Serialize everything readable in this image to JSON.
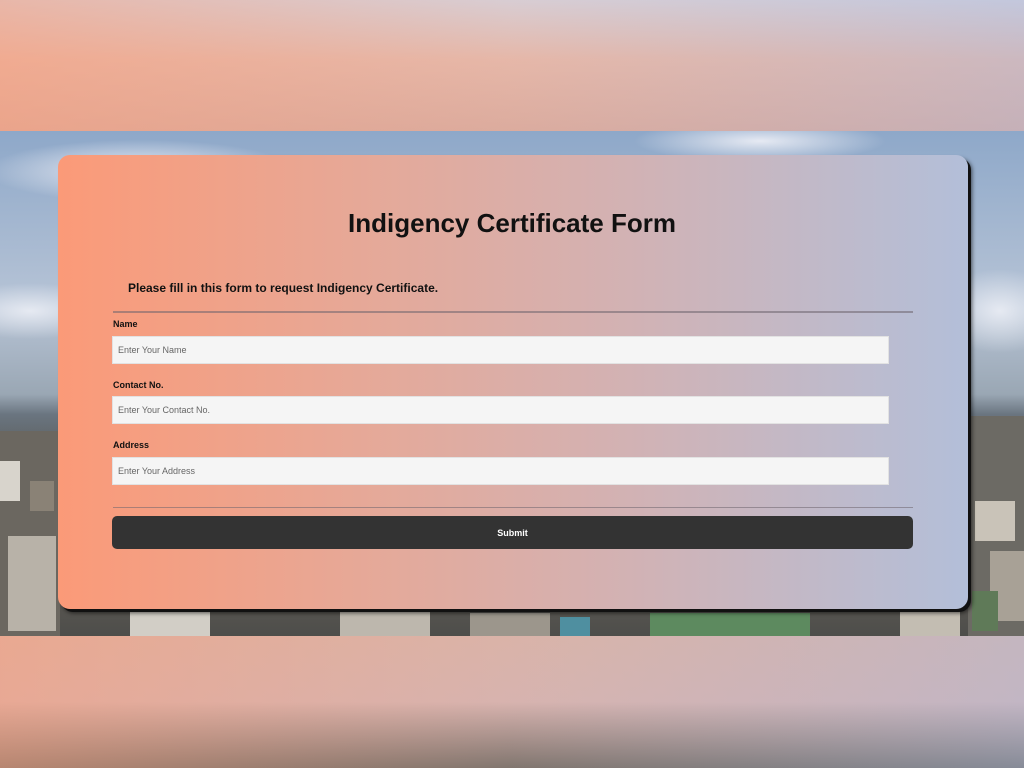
{
  "form": {
    "title": "Indigency Certificate Form",
    "subtitle": "Please fill in this form to request Indigency Certificate.",
    "fields": [
      {
        "label": "Name",
        "placeholder": "Enter Your Name",
        "value": ""
      },
      {
        "label": "Contact No.",
        "placeholder": "Enter Your Contact No.",
        "value": ""
      },
      {
        "label": "Address",
        "placeholder": "Enter Your Address",
        "value": ""
      }
    ],
    "submit_label": "Submit"
  },
  "colors": {
    "card_gradient_start": "#fb9a78",
    "card_gradient_end": "#b3bfd9",
    "input_background": "#f5f5f5",
    "button_background": "#333333",
    "button_text": "#ffffff"
  }
}
